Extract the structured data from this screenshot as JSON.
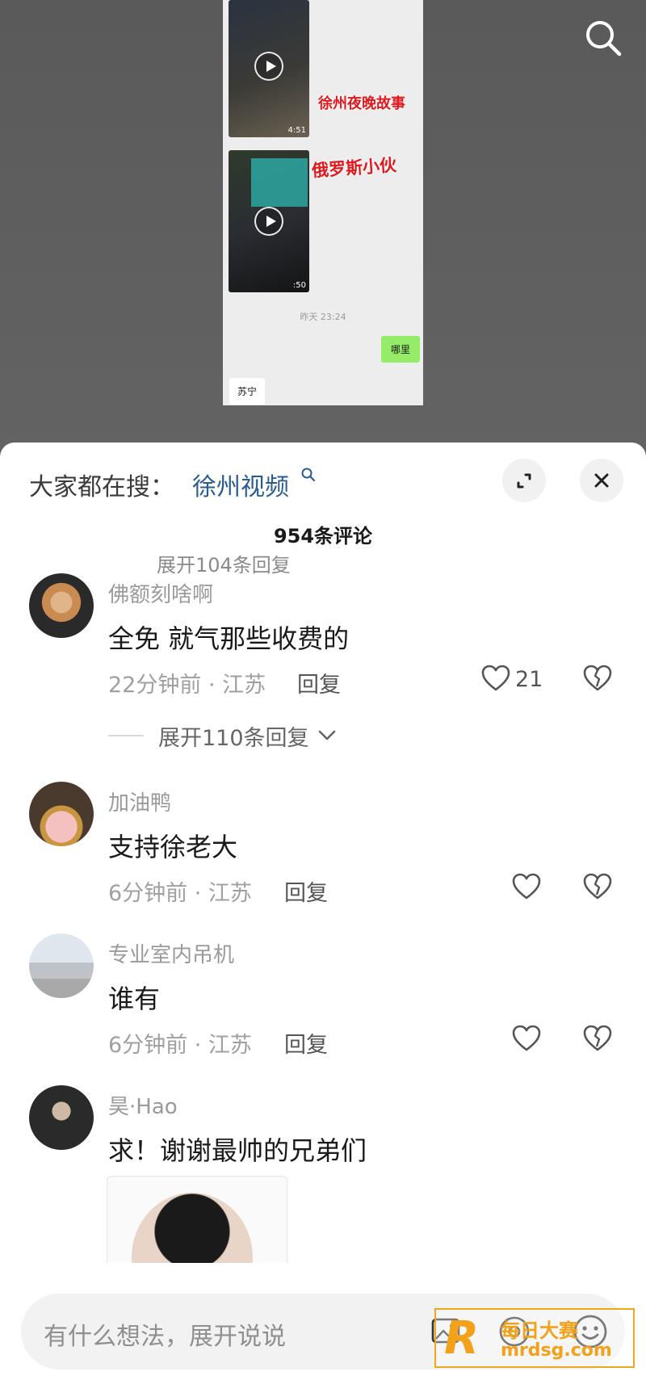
{
  "video": {
    "captions": [
      "徐州夜晚故事",
      "俄罗斯小伙"
    ],
    "durations": [
      "4:51",
      ":50"
    ],
    "chat_time": "昨天 23:24",
    "sent_message": "哪里",
    "received_message": "苏宁"
  },
  "sheet": {
    "hot_search_label": "大家都在搜：",
    "hot_search_term": "徐州视频",
    "comment_count": "954条评论",
    "cut_off_text": "展开104条回复"
  },
  "comments": [
    {
      "username": "佛额刻啥啊",
      "text": "全免   就气那些收费的",
      "time_location": "22分钟前 · 江苏",
      "reply_label": "回复",
      "likes": "21",
      "expand_label": "展开110条回复"
    },
    {
      "username": "加油鸭",
      "text": "支持徐老大",
      "time_location": "6分钟前 · 江苏",
      "reply_label": "回复"
    },
    {
      "username": "专业室内吊机",
      "text": "谁有",
      "time_location": "6分钟前 · 江苏",
      "reply_label": "回复"
    },
    {
      "username": "昊·Hao",
      "text": "求！谢谢最帅的兄弟们"
    }
  ],
  "input": {
    "placeholder": "有什么想法，展开说说"
  },
  "watermark": {
    "letter": "R",
    "title": "每日大赛",
    "domain": "mrdsg.com"
  },
  "colors": {
    "hot_search_term": "#2a5d8f",
    "caption_red": "#e0191e",
    "watermark_orange": "#f4a11a"
  }
}
